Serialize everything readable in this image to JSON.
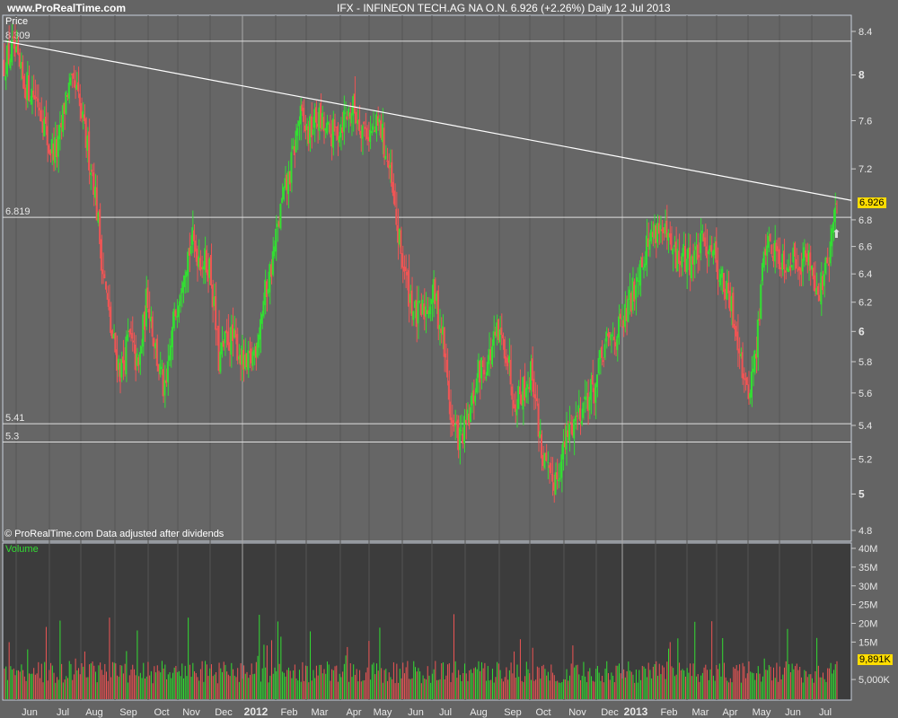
{
  "header": {
    "site": "www.ProRealTime.com",
    "title": "IFX - INFINEON TECH.AG NA O.N.    6.926 (+2.26%)    Daily  12 Jul 2013"
  },
  "price_panel": {
    "label": "Price",
    "footer": "© ProRealTime.com  Data adjusted after dividends",
    "last_price": "6.926"
  },
  "volume_panel": {
    "label": "Volume",
    "last_volume": "9,891K"
  },
  "colors": {
    "up": "#33dd33",
    "down": "#ee5555",
    "last_badge": "#ffdd00"
  },
  "chart_data": {
    "type": "candlestick",
    "title": "IFX - INFINEON TECH.AG NA O.N.",
    "scale": "log",
    "ylim": [
      4.8,
      8.4
    ],
    "y_ticks": [
      "8.4",
      "8",
      "7.6",
      "7.2",
      "6.8",
      "6.6",
      "6.4",
      "6.2",
      "6",
      "5.8",
      "5.6",
      "5.4",
      "5.2",
      "5",
      "4.8"
    ],
    "bold_ticks": [
      "8",
      "6",
      "5"
    ],
    "x_ticks": [
      "Jun",
      "Jul",
      "Aug",
      "Sep",
      "Oct",
      "Nov",
      "Dec",
      "2012",
      "Feb",
      "Mar",
      "Apr",
      "May",
      "Jun",
      "Jul",
      "Aug",
      "Sep",
      "Oct",
      "Nov",
      "Dec",
      "2013",
      "Feb",
      "Mar",
      "Apr",
      "May",
      "Jun",
      "Jul"
    ],
    "horizontal_lines": [
      {
        "label": "8.309",
        "value": 8.309
      },
      {
        "label": "6.819",
        "value": 6.819
      },
      {
        "label": "5.41",
        "value": 5.41
      },
      {
        "label": "5.3",
        "value": 5.3
      }
    ],
    "trendline": {
      "start": 8.309,
      "end": 6.95
    },
    "approx_closes": [
      8.11,
      8.23,
      7.95,
      7.87,
      7.75,
      7.38,
      7.35,
      7.87,
      7.87,
      7.49,
      7.12,
      6.45,
      5.97,
      5.74,
      5.97,
      5.74,
      6.27,
      5.85,
      5.57,
      6.09,
      6.45,
      6.64,
      6.51,
      6.45,
      5.8,
      5.97,
      5.91,
      5.74,
      5.88,
      6.21,
      6.51,
      6.91,
      7.19,
      7.64,
      7.49,
      7.64,
      7.49,
      7.49,
      7.64,
      7.71,
      7.56,
      7.49,
      7.56,
      7.19,
      6.68,
      6.33,
      6.09,
      6.15,
      6.27,
      5.97,
      5.41,
      5.31,
      5.45,
      5.74,
      5.8,
      5.97,
      5.91,
      5.57,
      5.63,
      5.74,
      5.26,
      5.05,
      5.15,
      5.36,
      5.47,
      5.57,
      5.63,
      5.88,
      5.97,
      6.03,
      6.21,
      6.48,
      6.64,
      6.77,
      6.64,
      6.51,
      6.51,
      6.51,
      6.61,
      6.64,
      6.39,
      6.21,
      5.97,
      5.57,
      5.85,
      6.64,
      6.58,
      6.51,
      6.51,
      6.51,
      6.51,
      6.27,
      6.45,
      6.926
    ],
    "volume_ticks": [
      "40M",
      "35M",
      "30M",
      "25M",
      "20M",
      "15M",
      "5,000K"
    ],
    "volume_ylim": [
      0,
      40000000
    ]
  }
}
